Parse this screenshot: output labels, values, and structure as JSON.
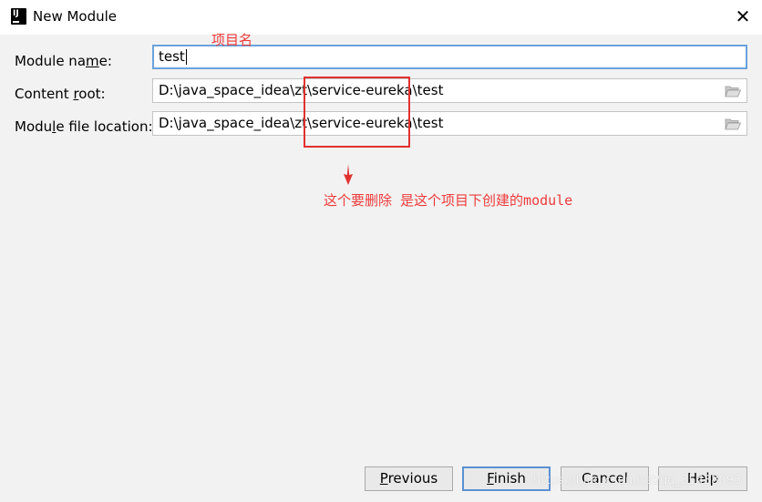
{
  "window": {
    "title": "New Module",
    "app_icon": "intellij-idea-icon",
    "close_icon": "close-icon"
  },
  "form": {
    "module_name": {
      "label_pre": "Module na",
      "label_mn": "m",
      "label_post": "e:",
      "value": "test"
    },
    "content_root": {
      "label_pre": "Content ",
      "label_mn": "r",
      "label_post": "oot:",
      "value": "D:\\java_space_idea\\zt\\service-eureka\\test"
    },
    "module_file_location": {
      "label_pre": "Modu",
      "label_mn": "l",
      "label_post": "e file location:",
      "value": "D:\\java_space_idea\\zt\\service-eureka\\test"
    }
  },
  "annotations": {
    "module_name_note": "项目名",
    "delete_note": "这个要删除  是这个项目下创建的module",
    "color": "#ee3a3a"
  },
  "buttons": {
    "previous": {
      "mn": "P",
      "rest": "revious"
    },
    "finish": {
      "mn": "F",
      "rest": "inish"
    },
    "cancel": {
      "label": "Cancel"
    },
    "help": {
      "label": "Help"
    }
  },
  "watermark": "https://blog.csdn.net/qq_35438093",
  "colors": {
    "dialog_bg": "#f2f2f2",
    "focus_border": "#6aa2dc",
    "default_button_border": "#5c91d2",
    "annotation_red": "#e23030"
  }
}
